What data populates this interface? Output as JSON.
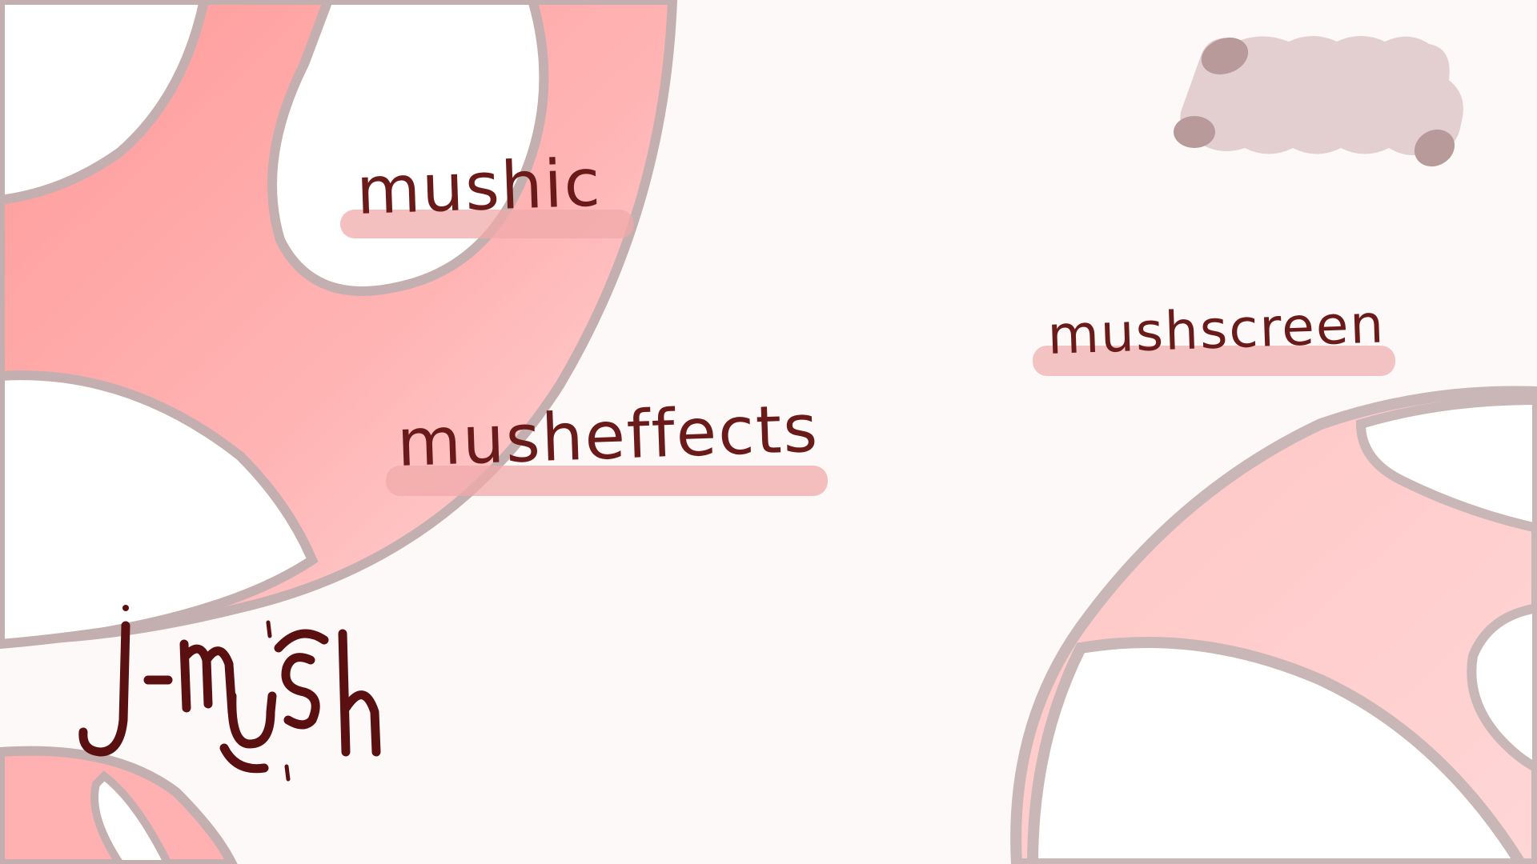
{
  "menu": {
    "options": [
      {
        "id": "music",
        "label": "mushic"
      },
      {
        "id": "effects",
        "label": "musheffects"
      },
      {
        "id": "screen",
        "label": "mushscreen"
      }
    ]
  },
  "logo": {
    "text": "j-mush"
  },
  "colors": {
    "background": "#fdf9f9",
    "mushroom_cap": "#ff9d9d",
    "mushroom_cap_light": "#ffc8c8",
    "outline": "#c0aaaa",
    "spot": "#ffffff",
    "text": "#6b1a1a",
    "highlight": "#f2b9b9",
    "cloud": "#e3cfcf",
    "cloud_dots": "#b99a9a"
  },
  "icons": {
    "back": "cloud-back-icon"
  }
}
